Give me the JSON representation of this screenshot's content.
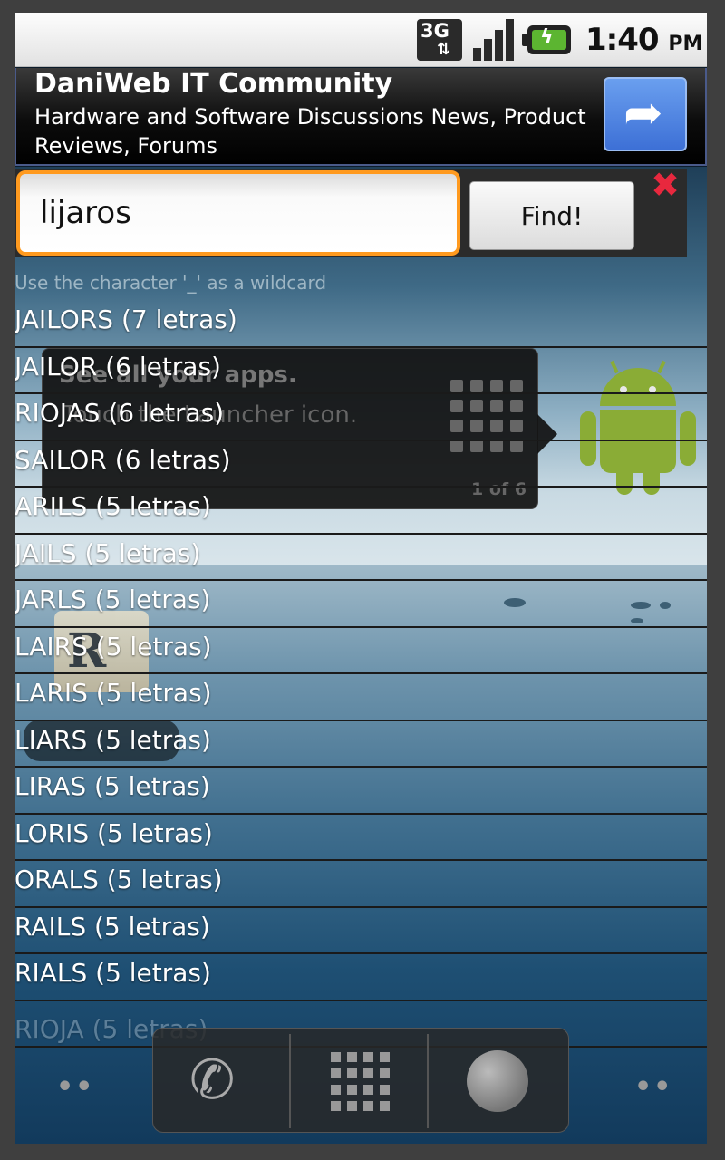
{
  "status_bar": {
    "network": "3G",
    "data_arrows": "⇅",
    "time": "1:40",
    "ampm": "PM",
    "icons": [
      "network-3g-icon",
      "signal-icon",
      "battery-charging-icon"
    ]
  },
  "ad": {
    "title": "DaniWeb IT Community",
    "description": "Hardware and Software Discussions News, Product Reviews, Forums",
    "button_icon": "share-arrow-icon",
    "button_glyph": "➦"
  },
  "search": {
    "value": "lijaros",
    "find_label": "Find!",
    "close_glyph": "✖",
    "hint": "Use the character '_' as a wildcard"
  },
  "launcher_tip": {
    "title": "See all your apps.",
    "subtitle": "Touch the Launcher icon.",
    "page": "1 of 6"
  },
  "app_icon": {
    "letter": "R"
  },
  "results": [
    "JAILORS (7 letras)",
    "JAILOR (6 letras)",
    "RIOJAS (6 letras)",
    "SAILOR (6 letras)",
    "ARILS (5 letras)",
    "JAILS (5 letras)",
    "JARLS (5 letras)",
    "LAIRS (5 letras)",
    "LARIS (5 letras)",
    "LIARS (5 letras)",
    "LIRAS (5 letras)",
    "LORIS (5 letras)",
    "ORALS (5 letras)",
    "RAILS (5 letras)",
    "RIALS (5 letras)",
    "RIOJA (5 letras)"
  ],
  "dock": {
    "phone_glyph": "✆",
    "icons": [
      "phone-icon",
      "app-drawer-icon",
      "browser-globe-icon"
    ]
  },
  "colors": {
    "focus_ring": "#ff9a1f",
    "close": "#e8283e",
    "ad_button": "#3d70d6",
    "android_green": "#8aac36"
  }
}
